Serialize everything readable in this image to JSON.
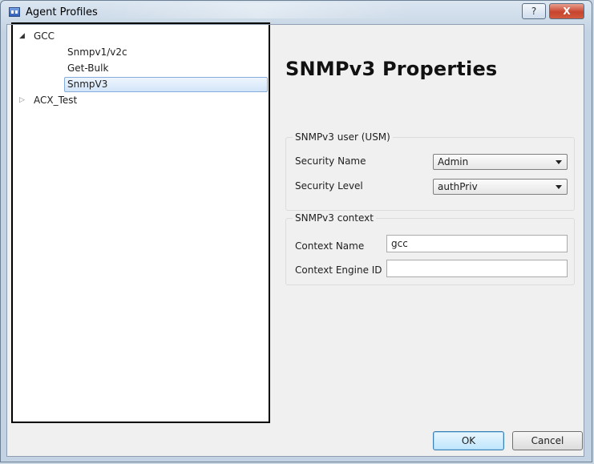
{
  "window": {
    "title": "Agent Profiles",
    "help_label": "?",
    "close_label": "X"
  },
  "tree": {
    "root": {
      "label": "GCC",
      "expanded": true,
      "children": [
        "Snmpv1/v2c",
        "Get-Bulk",
        "SnmpV3"
      ],
      "selected": "SnmpV3"
    },
    "second": {
      "label": "ACX_Test",
      "expanded": false
    }
  },
  "properties": {
    "title": "SNMPv3 Properties",
    "usm_group": {
      "title": "SNMPv3 user (USM)",
      "security_name_label": "Security Name",
      "security_name_value": "Admin",
      "security_level_label": "Security Level",
      "security_level_value": "authPriv"
    },
    "context_group": {
      "title": "SNMPv3 context",
      "context_name_label": "Context Name",
      "context_name_value": "gcc",
      "engine_id_label": "Context Engine ID",
      "engine_id_value": ""
    }
  },
  "buttons": {
    "ok": "OK",
    "cancel": "Cancel"
  },
  "colors": {
    "selection_fill": "#d3e5f9",
    "selection_border": "#84acdd",
    "close_red": "#c7442e"
  }
}
